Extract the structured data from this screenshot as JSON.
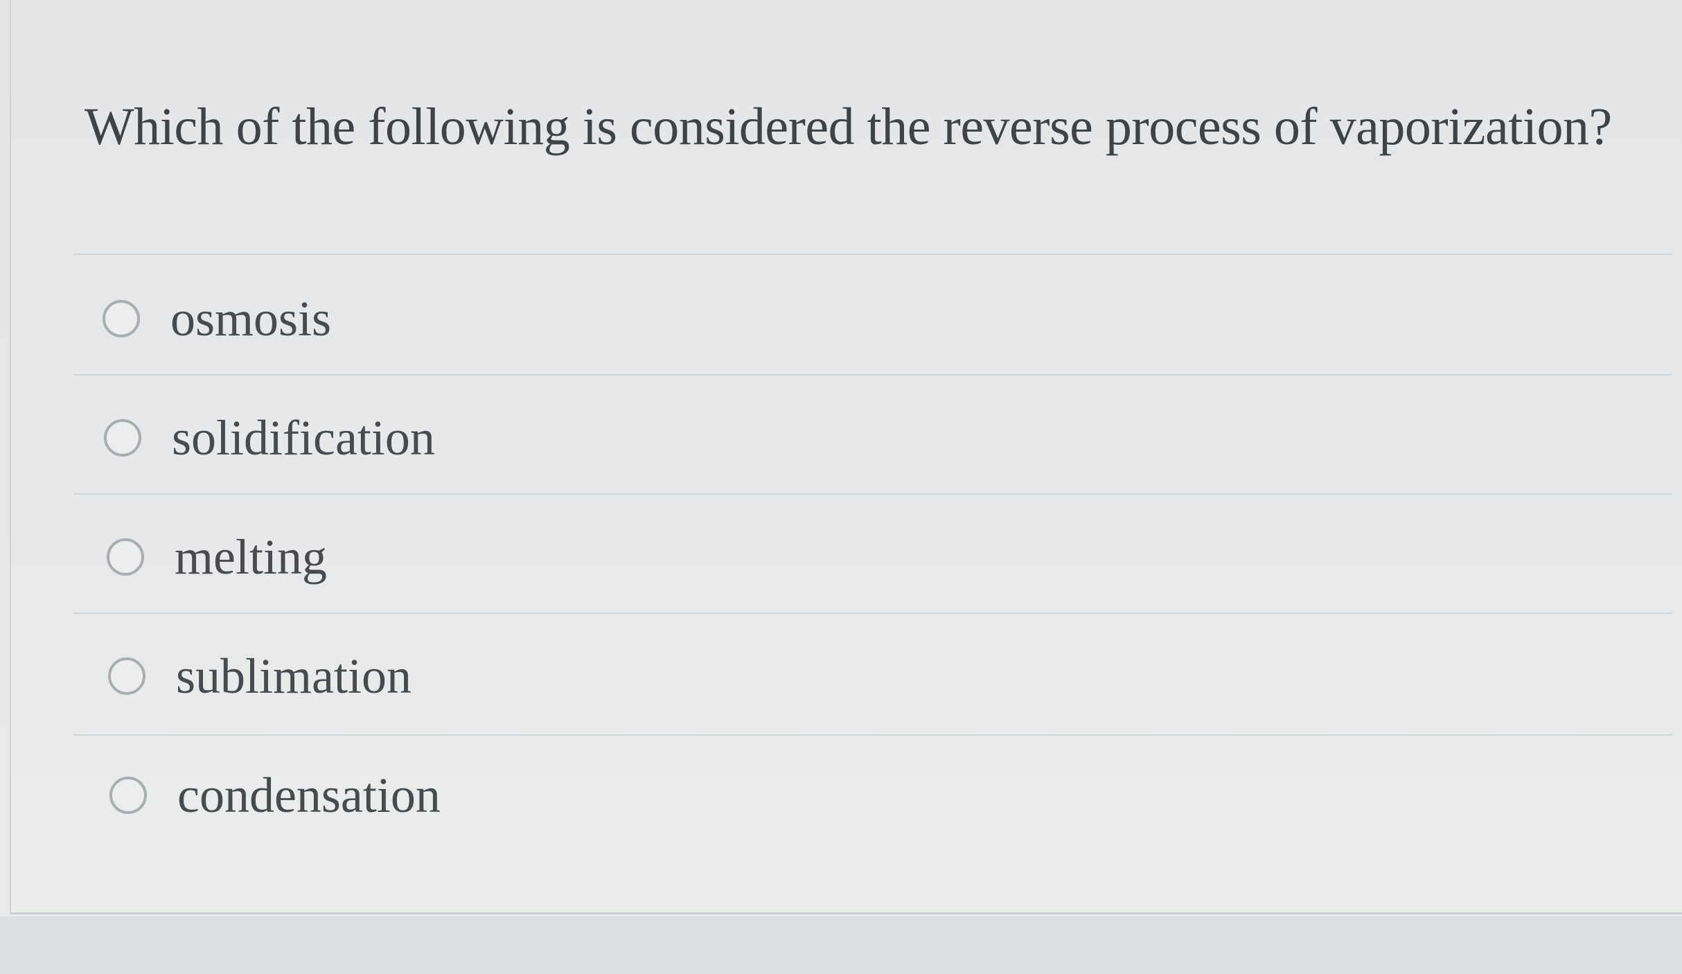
{
  "question": {
    "text": "Which of the following is considered the reverse process of vaporization?"
  },
  "options": [
    {
      "label": "osmosis",
      "selected": false
    },
    {
      "label": "solidification",
      "selected": false
    },
    {
      "label": "melting",
      "selected": false
    },
    {
      "label": "sublimation",
      "selected": false
    },
    {
      "label": "condensation",
      "selected": false
    }
  ],
  "colors": {
    "background": "#e6e7e8",
    "text": "#474a4f",
    "radio_border": "#a9adb2",
    "divider": "#d3d6d9"
  }
}
